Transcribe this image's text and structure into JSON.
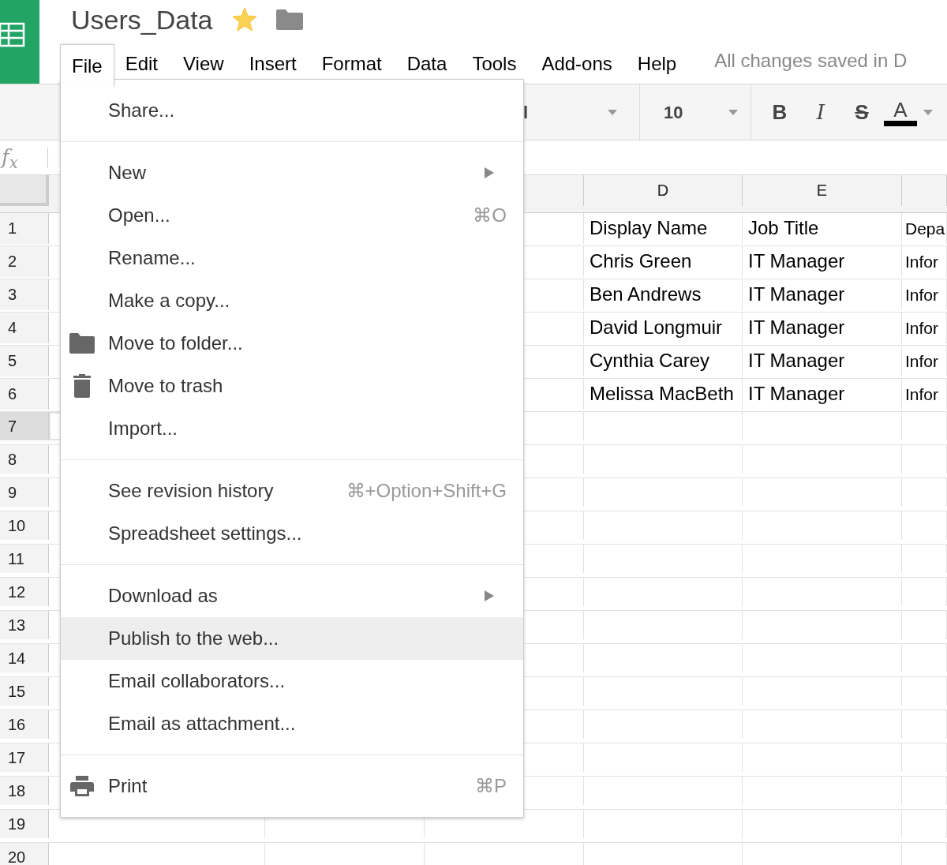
{
  "app": {
    "title": "Users_Data",
    "starred": true,
    "status": "All changes saved in D"
  },
  "menubar": [
    {
      "label": "File",
      "selected": true
    },
    {
      "label": "Edit",
      "selected": false
    },
    {
      "label": "View",
      "selected": false
    },
    {
      "label": "Insert",
      "selected": false
    },
    {
      "label": "Format",
      "selected": false
    },
    {
      "label": "Data",
      "selected": false
    },
    {
      "label": "Tools",
      "selected": false
    },
    {
      "label": "Add-ons",
      "selected": false
    },
    {
      "label": "Help",
      "selected": false
    }
  ],
  "toolbar": {
    "font_name": "l",
    "font_size": "10",
    "buttons": [
      {
        "kind": "bold",
        "label": "B"
      },
      {
        "kind": "italic",
        "label": "I"
      },
      {
        "kind": "strike",
        "label": "S"
      },
      {
        "kind": "color",
        "label": "A"
      }
    ]
  },
  "formula_bar": {
    "label": "f$_{x}$"
  },
  "sheet": {
    "column_headers": [
      "D",
      "E"
    ],
    "rows": [
      {
        "number": "1",
        "selected": false,
        "cells": [
          null,
          null,
          null,
          "Display Name",
          "Job Title",
          "Depa"
        ]
      },
      {
        "number": "2",
        "selected": false,
        "cells": [
          null,
          null,
          null,
          "Chris Green",
          "IT Manager",
          "Infor"
        ]
      },
      {
        "number": "3",
        "selected": false,
        "cells": [
          null,
          null,
          null,
          "Ben Andrews",
          "IT Manager",
          "Infor"
        ]
      },
      {
        "number": "4",
        "selected": false,
        "cells": [
          null,
          null,
          null,
          "David Longmuir",
          "IT Manager",
          "Infor"
        ]
      },
      {
        "number": "5",
        "selected": false,
        "cells": [
          null,
          null,
          null,
          "Cynthia Carey",
          "IT Manager",
          "Infor"
        ]
      },
      {
        "number": "6",
        "selected": false,
        "cells": [
          null,
          null,
          null,
          "Melissa MacBeth",
          "IT Manager",
          "Infor"
        ]
      },
      {
        "number": "7",
        "selected": true,
        "cells": [
          "",
          "",
          "",
          "",
          "",
          ""
        ]
      },
      {
        "number": "8",
        "selected": false,
        "cells": [
          "",
          "",
          "",
          "",
          "",
          ""
        ]
      },
      {
        "number": "9",
        "selected": false,
        "cells": [
          "",
          "",
          "",
          "",
          "",
          ""
        ]
      },
      {
        "number": "10",
        "selected": false,
        "cells": [
          "",
          "",
          "",
          "",
          "",
          ""
        ]
      },
      {
        "number": "11",
        "selected": false,
        "cells": [
          "",
          "",
          "",
          "",
          "",
          ""
        ]
      },
      {
        "number": "12",
        "selected": false,
        "cells": [
          "",
          "",
          "",
          "",
          "",
          ""
        ]
      },
      {
        "number": "13",
        "selected": false,
        "cells": [
          "",
          "",
          "",
          "",
          "",
          ""
        ]
      },
      {
        "number": "14",
        "selected": false,
        "cells": [
          "",
          "",
          "",
          "",
          "",
          ""
        ]
      },
      {
        "number": "15",
        "selected": false,
        "cells": [
          "",
          "",
          "",
          "",
          "",
          ""
        ]
      },
      {
        "number": "16",
        "selected": false,
        "cells": [
          "",
          "",
          "",
          "",
          "",
          ""
        ]
      },
      {
        "number": "17",
        "selected": false,
        "cells": [
          "",
          "",
          "",
          "",
          "",
          ""
        ]
      },
      {
        "number": "18",
        "selected": false,
        "cells": [
          "",
          "",
          "",
          "",
          "",
          ""
        ]
      },
      {
        "number": "19",
        "selected": false,
        "cells": [
          "",
          "",
          "",
          "",
          "",
          ""
        ]
      },
      {
        "number": "20",
        "selected": false,
        "cells": [
          "",
          "",
          "",
          "",
          "",
          ""
        ]
      }
    ]
  },
  "file_menu": {
    "sections": [
      {
        "items": [
          {
            "label": "Share...",
            "selected": false
          }
        ]
      },
      {
        "items": [
          {
            "label": "New",
            "kind": "submenu",
            "selected": false
          },
          {
            "label": "Open...",
            "shortcut": "⌘O",
            "selected": false
          },
          {
            "label": "Rename...",
            "selected": false
          },
          {
            "label": "Make a copy...",
            "selected": false
          },
          {
            "label": "Move to folder...",
            "kind": "folder",
            "selected": false
          },
          {
            "label": "Move to trash",
            "kind": "trash",
            "selected": false
          },
          {
            "label": "Import...",
            "selected": false
          }
        ]
      },
      {
        "items": [
          {
            "label": "See revision history",
            "shortcut": "⌘+Option+Shift+G",
            "selected": false
          },
          {
            "label": "Spreadsheet settings...",
            "selected": false
          }
        ]
      },
      {
        "items": [
          {
            "label": "Download as",
            "kind": "submenu",
            "selected": false
          },
          {
            "label": "Publish to the web...",
            "selected": true
          },
          {
            "label": "Email collaborators...",
            "selected": false
          },
          {
            "label": "Email as attachment...",
            "selected": false
          }
        ]
      },
      {
        "items": [
          {
            "label": "Print",
            "kind": "print",
            "shortcut": "⌘P",
            "selected": false
          }
        ]
      }
    ]
  }
}
